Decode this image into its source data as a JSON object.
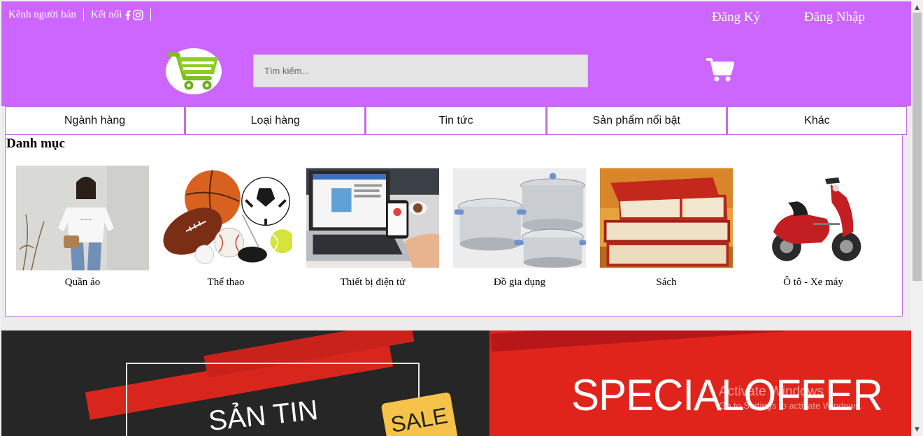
{
  "header": {
    "topbar": {
      "seller_channel": "Kênh người bán",
      "connect": "Kết nối"
    },
    "register": "Đăng Ký",
    "login": "Đăng Nhập",
    "search_placeholder": "Tìm kiếm..."
  },
  "nav": {
    "items": [
      {
        "label": "Ngành hàng"
      },
      {
        "label": "Loại hàng"
      },
      {
        "label": "Tin tức"
      },
      {
        "label": "Sản phẩm nổi bật"
      },
      {
        "label": "Khác"
      }
    ]
  },
  "categories": {
    "title": "Danh mục",
    "items": [
      {
        "label": "Quần áo"
      },
      {
        "label": "Thể thao"
      },
      {
        "label": "Thiết bị điện tử"
      },
      {
        "label": "Đồ gia dụng"
      },
      {
        "label": "Sách"
      },
      {
        "label": "Ô tô - Xe máy"
      }
    ]
  },
  "banner": {
    "main_text": "SPECIALOFFER",
    "sub_text": "SẢN TIN",
    "sale_label": "SALE"
  },
  "watermark": {
    "line1": "Activate Windows",
    "line2": "Go to Settings to activate Windows."
  },
  "colors": {
    "header_bg": "#cc66ff",
    "nav_border": "#c46ce8",
    "banner_red": "#e0241c"
  }
}
